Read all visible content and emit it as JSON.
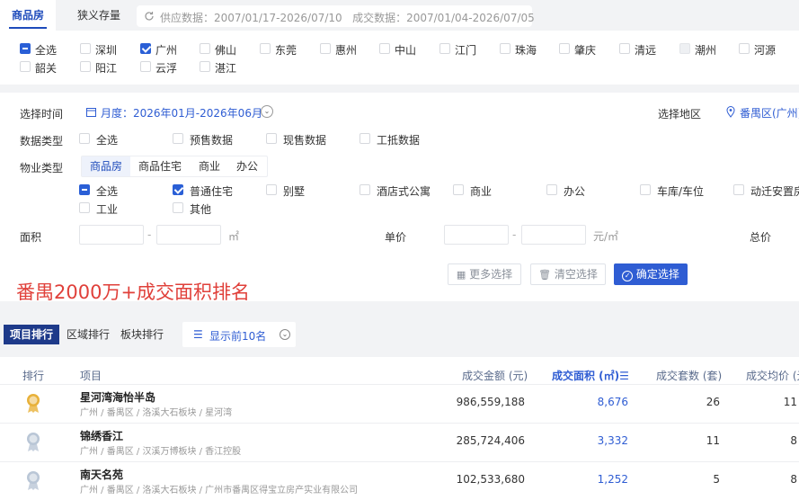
{
  "top_tabs": {
    "tab1": "商品房",
    "tab2": "狭义存量",
    "data_info": "供应数据：2007/01/17-2026/07/10   成交数据：2007/01/04-2026/07/05"
  },
  "regions": [
    {
      "label": "全选",
      "state": "ind"
    },
    {
      "label": "深圳",
      "state": "off"
    },
    {
      "label": "广州",
      "state": "on"
    },
    {
      "label": "佛山",
      "state": "off"
    },
    {
      "label": "东莞",
      "state": "off"
    },
    {
      "label": "惠州",
      "state": "off"
    },
    {
      "label": "中山",
      "state": "off"
    },
    {
      "label": "江门",
      "state": "off"
    },
    {
      "label": "珠海",
      "state": "off"
    },
    {
      "label": "肇庆",
      "state": "off"
    },
    {
      "label": "清远",
      "state": "off"
    },
    {
      "label": "潮州",
      "state": "dis"
    },
    {
      "label": "河源",
      "state": "off"
    },
    {
      "label": "韶关",
      "state": "off"
    },
    {
      "label": "阳江",
      "state": "off"
    },
    {
      "label": "云浮",
      "state": "off"
    },
    {
      "label": "湛江",
      "state": "off"
    }
  ],
  "filters": {
    "time_label": "选择时间",
    "time_value": "月度：2026年01月-2026年06月",
    "area_label": "选择地区",
    "area_value": "番禺区(广州)",
    "data_type_label": "数据类型",
    "data_types": [
      "全选",
      "预售数据",
      "现售数据",
      "工抵数据"
    ],
    "property_type_label": "物业类型",
    "property_segments": [
      "商品房",
      "商品住宅",
      "商业",
      "办公"
    ],
    "property_row1": [
      {
        "label": "全选",
        "state": "ind"
      },
      {
        "label": "普通住宅",
        "state": "on"
      },
      {
        "label": "别墅",
        "state": "off"
      },
      {
        "label": "酒店式公寓",
        "state": "off"
      },
      {
        "label": "商业",
        "state": "off"
      },
      {
        "label": "办公",
        "state": "off"
      },
      {
        "label": "车库/车位",
        "state": "off"
      },
      {
        "label": "动迁安置房",
        "state": "off"
      }
    ],
    "property_row2": [
      {
        "label": "工业",
        "state": "off"
      },
      {
        "label": "其他",
        "state": "off"
      }
    ],
    "area_field_label": "面积",
    "area_unit": "㎡",
    "price_label": "单价",
    "price_unit": "元/㎡",
    "total_label": "总价",
    "dash": "-"
  },
  "actions": {
    "more": "更多选择",
    "clear": "清空选择",
    "confirm": "确定选择"
  },
  "annotation": "番禺2000万+成交面积排名",
  "ranking": {
    "tabs": [
      "项目排行",
      "区域排行",
      "板块排行"
    ],
    "show_top": "显示前10名",
    "headers": {
      "rank": "排行",
      "project": "项目",
      "amount": "成交金额 (元)",
      "area": "成交面积 (㎡)",
      "count": "成交套数 (套)",
      "avg": "成交均价 (元"
    },
    "rows": [
      {
        "name": "星河湾海怡半岛",
        "path": "广州 / 番禺区 / 洛溪大石板块 / 星河湾",
        "amount": "986,559,188",
        "area": "8,676",
        "count": "26",
        "avg": "11",
        "medal": "gold"
      },
      {
        "name": "锦绣香江",
        "path": "广州 / 番禺区 / 汉溪万博板块 / 香江控股",
        "amount": "285,724,406",
        "area": "3,332",
        "count": "11",
        "avg": "8",
        "medal": "silver"
      },
      {
        "name": "南天名苑",
        "path": "广州 / 番禺区 / 洛溪大石板块 / 广州市番禺区得宝立房产实业有限公司",
        "amount": "102,533,680",
        "area": "1,252",
        "count": "5",
        "avg": "8",
        "medal": "silver"
      }
    ]
  },
  "colors": {
    "accent": "#2f5dd3",
    "annotation": "#e0403a",
    "gold": "#e8b13a",
    "silver": "#b9c6d6"
  }
}
